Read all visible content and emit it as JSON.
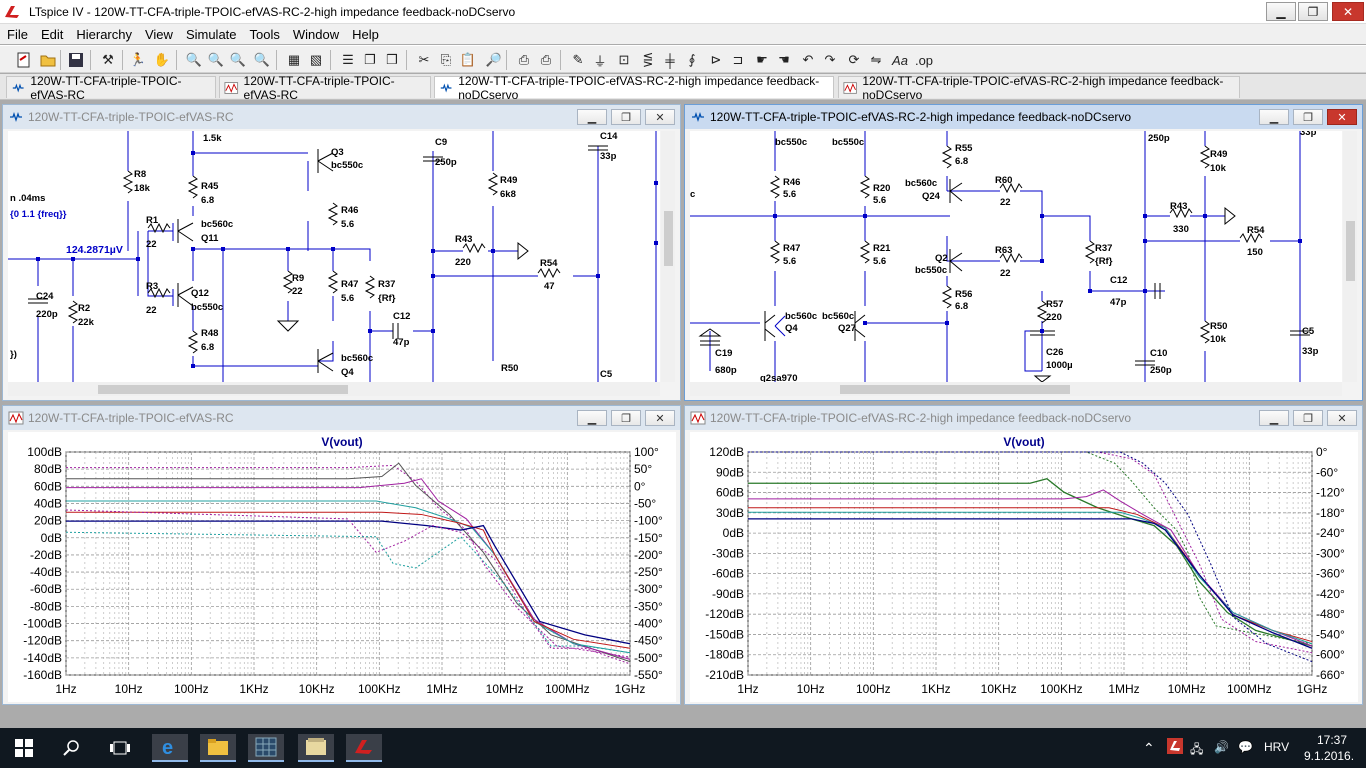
{
  "app": {
    "title": "LTspice IV - 120W-TT-CFA-triple-TPOIC-efVAS-RC-2-high impedance feedback-noDCservo"
  },
  "menu": [
    "File",
    "Edit",
    "Hierarchy",
    "View",
    "Simulate",
    "Tools",
    "Window",
    "Help"
  ],
  "tabs": [
    {
      "label": "120W-TT-CFA-triple-TPOIC-efVAS-RC",
      "icon": "schematic-icon"
    },
    {
      "label": "120W-TT-CFA-triple-TPOIC-efVAS-RC",
      "icon": "waveform-icon"
    },
    {
      "label": "120W-TT-CFA-triple-TPOIC-efVAS-RC-2-high impedance feedback-noDCservo",
      "icon": "schematic-icon"
    },
    {
      "label": "120W-TT-CFA-triple-TPOIC-efVAS-RC-2-high impedance feedback-noDCservo",
      "icon": "waveform-icon"
    }
  ],
  "windows": {
    "sch1": {
      "title": "120W-TT-CFA-triple-TPOIC-efVAS-RC"
    },
    "sch2": {
      "title": "120W-TT-CFA-triple-TPOIC-efVAS-RC-2-high impedance feedback-noDCservo"
    },
    "plot1": {
      "title": "120W-TT-CFA-triple-TPOIC-efVAS-RC"
    },
    "plot2": {
      "title": "120W-TT-CFA-triple-TPOIC-efVAS-RC-2-high impedance feedback-noDCservo"
    }
  },
  "schematic1": {
    "labels": {
      "l1": "1.5k",
      "l2": "Q3",
      "l3": "bc550c",
      "l4": "C9",
      "l5": "250p",
      "l6": "C14",
      "l7": "33p",
      "l8": "R8",
      "l9": "18k",
      "l10": "R45",
      "l11": "6.8",
      "l12": "R49",
      "l13": "6k8",
      "l14": "n .04ms",
      "l15": "{0 1.1 {freq}}",
      "l16": "R1",
      "l17": "22",
      "l18": "bc560c",
      "l19": "Q11",
      "l20": "R46",
      "l21": "5.6",
      "l22": "R43",
      "l23": "220",
      "l24": "124.2871µV",
      "l25": "R9",
      "l26": "22",
      "l27": "R47",
      "l28": "5.6",
      "l29": "R37",
      "l30": "{Rf}",
      "l31": "R54",
      "l32": "47",
      "l33": "R3",
      "l34": "22",
      "l35": "Q12",
      "l36": "bc550c",
      "l37": "C24",
      "l38": "220p",
      "l39": "R2",
      "l40": "22k",
      "l41": "C12",
      "l42": "47p",
      "l43": "R48",
      "l44": "6.8",
      "l45": "bc560c",
      "l46": "Q4",
      "l47": "R50",
      "l48": "C5",
      "l49": "})"
    }
  },
  "schematic2": {
    "labels": {
      "m1": "bc550c",
      "m2": "bc550c",
      "m3": "250p",
      "m4": "33p",
      "m5": "R55",
      "m6": "6.8",
      "m7": "R49",
      "m8": "10k",
      "m9": "R46",
      "m10": "5.6",
      "m11": "R20",
      "m12": "5.6",
      "m13": "bc560c",
      "m14": "Q24",
      "m15": "R60",
      "m16": "22",
      "m17": "R43",
      "m18": "330",
      "m19": "R47",
      "m20": "5.6",
      "m21": "R21",
      "m22": "5.6",
      "m23": "Q2",
      "m24": "bc550c",
      "m25": "R63",
      "m26": "22",
      "m27": "R37",
      "m28": "{Rf}",
      "m29": "R54",
      "m30": "150",
      "m31": "C12",
      "m32": "47p",
      "m33": "R56",
      "m34": "6.8",
      "m35": "R57",
      "m36": "220",
      "m37": "bc560c",
      "m38": "bc560c",
      "m39": "Q4",
      "m40": "Q27",
      "m41": "R50",
      "m42": "10k",
      "m43": "C5",
      "m44": "33p",
      "m45": "C26",
      "m46": "1000µ",
      "m47": "C19",
      "m48": "680p",
      "m49": "C10",
      "m50": "250p",
      "m51": "q2sa970",
      "m52": "c"
    }
  },
  "plot1": {
    "trace": "V(vout)",
    "xticks": [
      "1Hz",
      "10Hz",
      "100Hz",
      "1KHz",
      "10KHz",
      "100KHz",
      "1MHz",
      "10MHz",
      "100MHz",
      "1GHz"
    ],
    "yticks": [
      "100dB",
      "80dB",
      "60dB",
      "40dB",
      "20dB",
      "0dB",
      "-20dB",
      "-40dB",
      "-60dB",
      "-80dB",
      "-100dB",
      "-120dB",
      "-140dB",
      "-160dB"
    ],
    "rticks": [
      "100°",
      "50°",
      "0°",
      "-50°",
      "-100°",
      "-150°",
      "-200°",
      "-250°",
      "-300°",
      "-350°",
      "-400°",
      "-450°",
      "-500°",
      "-550°"
    ]
  },
  "plot2": {
    "trace": "V(vout)",
    "xticks": [
      "1Hz",
      "10Hz",
      "100Hz",
      "1KHz",
      "10KHz",
      "100KHz",
      "1MHz",
      "10MHz",
      "100MHz",
      "1GHz"
    ],
    "yticks": [
      "120dB",
      "90dB",
      "60dB",
      "30dB",
      "0dB",
      "-30dB",
      "-60dB",
      "-90dB",
      "-120dB",
      "-150dB",
      "-180dB",
      "-210dB"
    ],
    "rticks": [
      "0°",
      "-60°",
      "-120°",
      "-180°",
      "-240°",
      "-300°",
      "-360°",
      "-420°",
      "-480°",
      "-540°",
      "-600°",
      "-660°"
    ]
  },
  "colors": {
    "trace_blue": "#000080",
    "trace_green": "#2a7a2a",
    "trace_purple": "#a020a0",
    "trace_red": "#c01818",
    "trace_teal": "#20a0a0",
    "grid": "#9a9a9a",
    "wire": "#0000c8",
    "accent": "#c8372d"
  },
  "taskbar": {
    "time": "17:37",
    "date": "9.1.2016.",
    "lang": "HRV"
  }
}
